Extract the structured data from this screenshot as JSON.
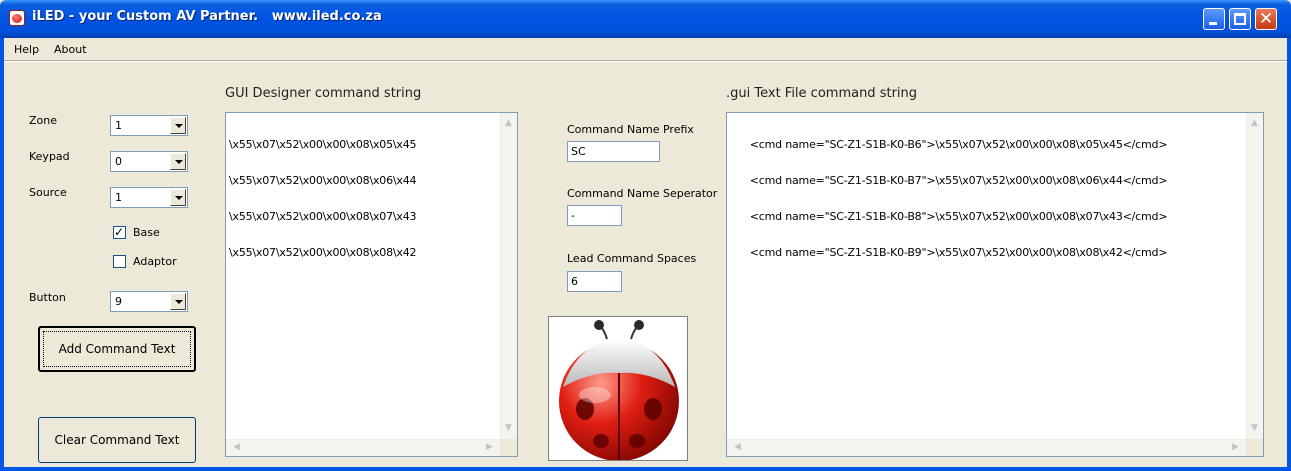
{
  "window": {
    "title": "iLED - your Custom AV Partner.   www.iled.co.za",
    "minimize_glyph": "_",
    "close_glyph": "✕"
  },
  "menu": [
    {
      "label": "Help"
    },
    {
      "label": "About"
    }
  ],
  "left_panel": {
    "zone": {
      "label": "Zone",
      "value": "1"
    },
    "keypad": {
      "label": "Keypad",
      "value": "0"
    },
    "source": {
      "label": "Source",
      "value": "1"
    },
    "base_checkbox": {
      "label": "Base",
      "checked": true,
      "mark": "✓"
    },
    "adaptor_checkbox": {
      "label": "Adaptor",
      "checked": false
    },
    "button": {
      "label": "Button",
      "value": "9"
    },
    "add_command_text_label": "Add Command Text",
    "clear_command_text_label": "Clear Command Text"
  },
  "gui_designer": {
    "title": "GUI Designer command string",
    "lines": [
      "\\x55\\x07\\x52\\x00\\x00\\x08\\x05\\x45",
      "\\x55\\x07\\x52\\x00\\x00\\x08\\x06\\x44",
      "\\x55\\x07\\x52\\x00\\x00\\x08\\x07\\x43",
      "\\x55\\x07\\x52\\x00\\x00\\x08\\x08\\x42"
    ]
  },
  "middle_panel": {
    "prefix": {
      "label": "Command Name Prefix",
      "value": "SC"
    },
    "separator": {
      "label": "Command Name Seperator",
      "value": "-"
    },
    "lead_spaces": {
      "label": "Lead Command Spaces",
      "value": "6"
    }
  },
  "gui_text_file": {
    "title": ".gui Text File command string",
    "lines": [
      "      <cmd name=\"SC-Z1-S1B-K0-B6\">\\x55\\x07\\x52\\x00\\x00\\x08\\x05\\x45</cmd>",
      "      <cmd name=\"SC-Z1-S1B-K0-B7\">\\x55\\x07\\x52\\x00\\x00\\x08\\x06\\x44</cmd>",
      "      <cmd name=\"SC-Z1-S1B-K0-B8\">\\x55\\x07\\x52\\x00\\x00\\x08\\x07\\x43</cmd>",
      "      <cmd name=\"SC-Z1-S1B-K0-B9\">\\x55\\x07\\x52\\x00\\x00\\x08\\x08\\x42</cmd>"
    ]
  },
  "scroll_glyphs": {
    "up": "▲",
    "down": "▼",
    "left": "◀",
    "right": "▶"
  }
}
